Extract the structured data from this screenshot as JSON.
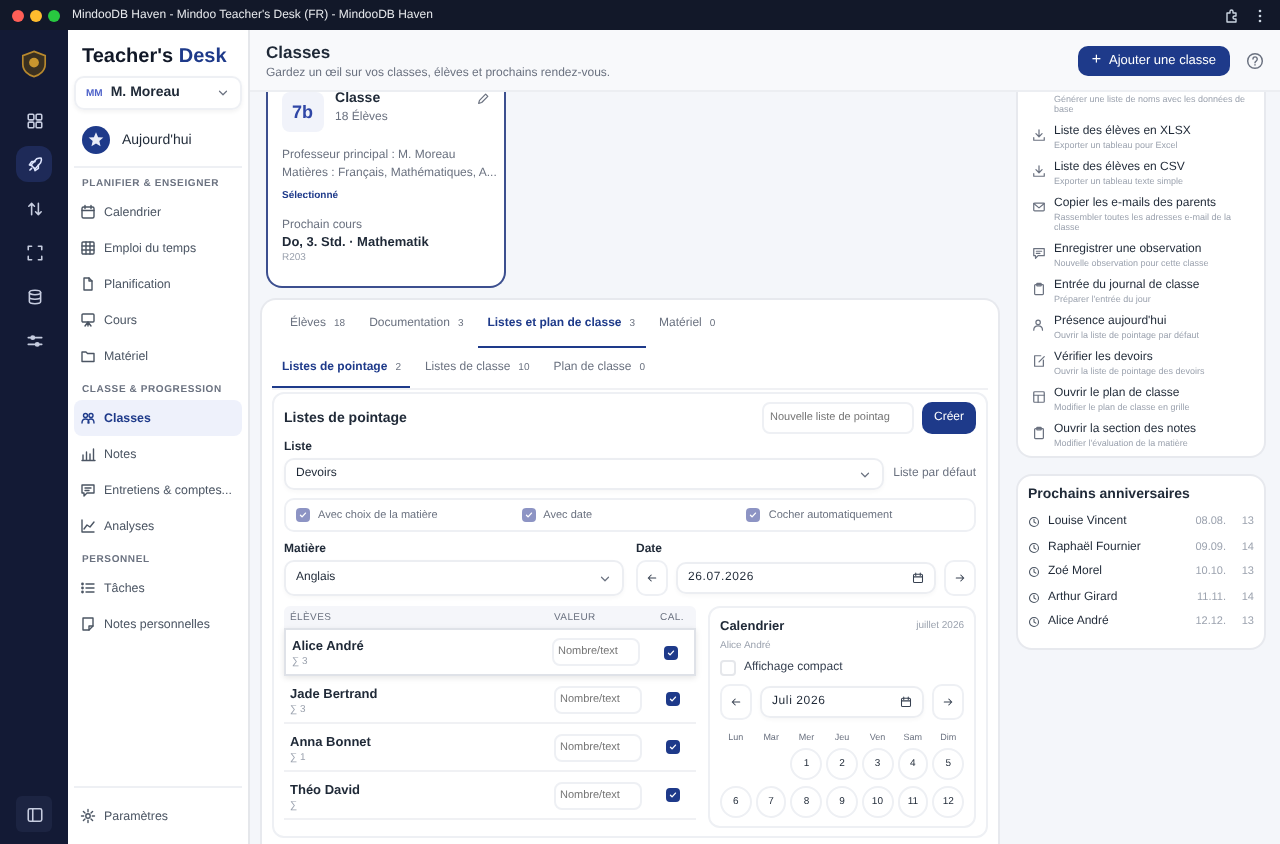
{
  "window": {
    "title": "MindooDB Haven - Mindoo Teacher's Desk (FR) - MindooDB Haven"
  },
  "rail": [
    {
      "kind": "grid",
      "selected": false
    },
    {
      "kind": "rocket",
      "selected": true
    },
    {
      "kind": "sort-arrows",
      "selected": false
    },
    {
      "kind": "scan-frame",
      "selected": false
    },
    {
      "kind": "database",
      "selected": false
    },
    {
      "kind": "sliders",
      "selected": false
    }
  ],
  "sidebar": {
    "brand": "Teacher's",
    "brand_accent": "Desk",
    "user": {
      "initials": "MM",
      "name": "M. Moreau"
    },
    "today": "Aujourd'hui",
    "sections": [
      {
        "title": "PLANIFIER & ENSEIGNER",
        "items": [
          {
            "label": "Calendrier",
            "kind": "calendar",
            "selected": false
          },
          {
            "label": "Emploi du temps",
            "kind": "table",
            "selected": false
          },
          {
            "label": "Planification",
            "kind": "document",
            "selected": false
          },
          {
            "label": "Cours",
            "kind": "easel",
            "selected": false
          },
          {
            "label": "Matériel",
            "kind": "folder",
            "selected": false
          }
        ]
      },
      {
        "title": "CLASSE & PROGRESSION",
        "items": [
          {
            "label": "Classes",
            "kind": "people",
            "selected": true
          },
          {
            "label": "Notes",
            "kind": "bar-chart",
            "selected": false
          },
          {
            "label": "Entretiens & comptes...",
            "kind": "chat",
            "selected": false
          },
          {
            "label": "Analyses",
            "kind": "line-chart",
            "selected": false
          }
        ]
      },
      {
        "title": "PERSONNEL",
        "items": [
          {
            "label": "Tâches",
            "kind": "list",
            "selected": false
          },
          {
            "label": "Notes personnelles",
            "kind": "note",
            "selected": false
          }
        ]
      }
    ],
    "settings": "Paramètres"
  },
  "header": {
    "title": "Classes",
    "subtitle": "Gardez un œil sur vos classes, élèves et prochains rendez-vous.",
    "add_symbol": "+",
    "add_button": "Ajouter une classe"
  },
  "class_card": {
    "code": "7b",
    "title": "Classe",
    "count": "18 Élèves",
    "teacher": "Professeur principal : M. Moreau",
    "subjects": "Matières : Français, Mathématiques, A...",
    "status": "Sélectionné",
    "selected": true,
    "next_label": "Prochain cours",
    "next_lesson": "Do, 3. Std. · Mathematik",
    "room": "R203"
  },
  "tabs": [
    {
      "label": "Élèves",
      "count": "18",
      "selected": false
    },
    {
      "label": "Documentation",
      "count": "3",
      "selected": false
    },
    {
      "label": "Listes et plan de classe",
      "count": "3",
      "selected": true
    },
    {
      "label": "Matériel",
      "count": "0",
      "selected": false
    }
  ],
  "subtabs": [
    {
      "label": "Listes de pointage",
      "count": "2",
      "selected": true
    },
    {
      "label": "Listes de classe",
      "count": "10",
      "selected": false
    },
    {
      "label": "Plan de classe",
      "count": "0",
      "selected": false
    }
  ],
  "pointage": {
    "title": "Listes de pointage",
    "new_placeholder": "Nouvelle liste de pointag",
    "create_button": "Créer",
    "list_label": "Liste",
    "list_value": "Devoirs",
    "default_label": "Liste par défaut",
    "options": [
      {
        "label": "Avec choix de la matière",
        "checked": true
      },
      {
        "label": "Avec date",
        "checked": true
      },
      {
        "label": "Cocher automatiquement",
        "checked": true
      }
    ],
    "subject_label": "Matière",
    "subject_value": "Anglais",
    "date_label": "Date",
    "date_value": "26.07.2026",
    "columns": [
      "ÉLÈVES",
      "VALEUR",
      "CAL."
    ],
    "rows": [
      {
        "name": "Alice André",
        "sum": "∑ 3",
        "placeholder": "Nombre/text",
        "checked": true,
        "selected": true
      },
      {
        "name": "Jade Bertrand",
        "sum": "∑ 3",
        "placeholder": "Nombre/text",
        "checked": true,
        "selected": false
      },
      {
        "name": "Anna Bonnet",
        "sum": "∑ 1",
        "placeholder": "Nombre/text",
        "checked": true,
        "selected": false
      },
      {
        "name": "Théo David",
        "sum": "∑",
        "placeholder": "Nombre/text",
        "checked": true,
        "selected": false
      }
    ]
  },
  "calendar": {
    "title": "Calendrier",
    "month": "juillet 2026",
    "student": "Alice André",
    "compact": {
      "label": "Affichage compact",
      "checked": false
    },
    "month_field": "Juli 2026",
    "weekdays": [
      "Lun",
      "Mar",
      "Mer",
      "Jeu",
      "Ven",
      "Sam",
      "Dim"
    ],
    "weeks": [
      [
        "1",
        "2",
        "3",
        "4",
        "5"
      ],
      [
        "6",
        "7",
        "8",
        "9",
        "10",
        "11",
        "12"
      ]
    ]
  },
  "actions": [
    {
      "desc": "Générer une liste de noms avec les données de base"
    },
    {
      "kind": "download",
      "title": "Liste des élèves en XLSX",
      "desc": "Exporter un tableau pour Excel"
    },
    {
      "kind": "download",
      "title": "Liste des élèves en CSV",
      "desc": "Exporter un tableau texte simple"
    },
    {
      "kind": "mail",
      "title": "Copier les e-mails des parents",
      "desc": "Rassembler toutes les adresses e-mail de la classe"
    },
    {
      "kind": "chat",
      "title": "Enregistrer une observation",
      "desc": "Nouvelle observation pour cette classe"
    },
    {
      "kind": "clipboard",
      "title": "Entrée du journal de classe",
      "desc": "Préparer l'entrée du jour"
    },
    {
      "kind": "person",
      "title": "Présence aujourd'hui",
      "desc": "Ouvrir la liste de pointage par défaut"
    },
    {
      "kind": "edit-document",
      "title": "Vérifier les devoirs",
      "desc": "Ouvrir la liste de pointage des devoirs"
    },
    {
      "kind": "layout",
      "title": "Ouvrir le plan de classe",
      "desc": "Modifier le plan de classe en grille"
    },
    {
      "kind": "clipboard",
      "title": "Ouvrir la section des notes",
      "desc": "Modifier l'évaluation de la matière"
    }
  ],
  "birthdays": {
    "title": "Prochains anniversaires",
    "items": [
      {
        "name": "Louise Vincent",
        "date": "08.08.",
        "age": "13"
      },
      {
        "name": "Raphaël Fournier",
        "date": "09.09.",
        "age": "14"
      },
      {
        "name": "Zoé Morel",
        "date": "10.10.",
        "age": "13"
      },
      {
        "name": "Arthur Girard",
        "date": "11.11.",
        "age": "14"
      },
      {
        "name": "Alice André",
        "date": "12.12.",
        "age": "13"
      }
    ]
  }
}
